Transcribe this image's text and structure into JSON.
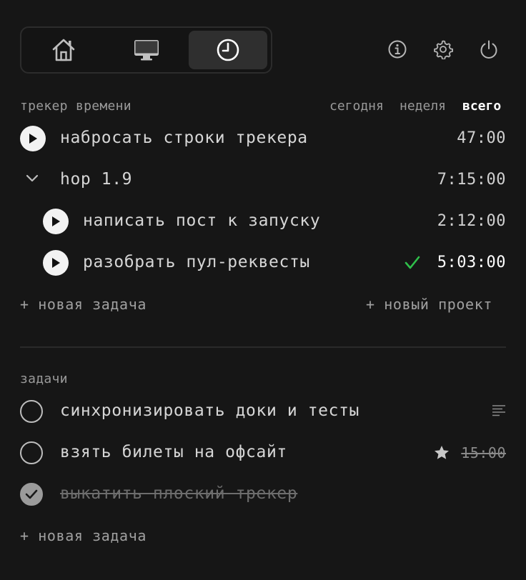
{
  "nav": {
    "segments": [
      {
        "name": "home",
        "icon": "home-icon"
      },
      {
        "name": "screen",
        "icon": "monitor-icon"
      },
      {
        "name": "clock",
        "icon": "clock-icon",
        "active": true
      }
    ],
    "actions": [
      "info-icon",
      "gear-icon",
      "power-icon"
    ]
  },
  "tracker": {
    "title": "трекер времени",
    "periods": {
      "today": "сегодня",
      "week": "неделя",
      "total": "всего"
    },
    "active_period": "всего",
    "rows": [
      {
        "label": "набросать строки трекера",
        "time": "47:00"
      },
      {
        "label": "hop 1.9",
        "time": "7:15:00"
      },
      {
        "label": "написать пост к запуску",
        "time": "2:12:00"
      },
      {
        "label": "разобрать пул-реквесты",
        "time": "5:03:00",
        "checked": true
      }
    ],
    "add_task": "+ новая задача",
    "add_project": "+ новый проект"
  },
  "tasks": {
    "title": "задачи",
    "items": [
      {
        "label": "синхронизировать доки и тесты",
        "done": false
      },
      {
        "label": "взять билеты на офсайт",
        "done": false,
        "time": "15:00"
      },
      {
        "label": "выкатить плоский трекер",
        "done": true
      }
    ],
    "add_task": "+ новая задача"
  },
  "colors": {
    "background": "#161616",
    "accent_check": "#2fbf4a"
  }
}
